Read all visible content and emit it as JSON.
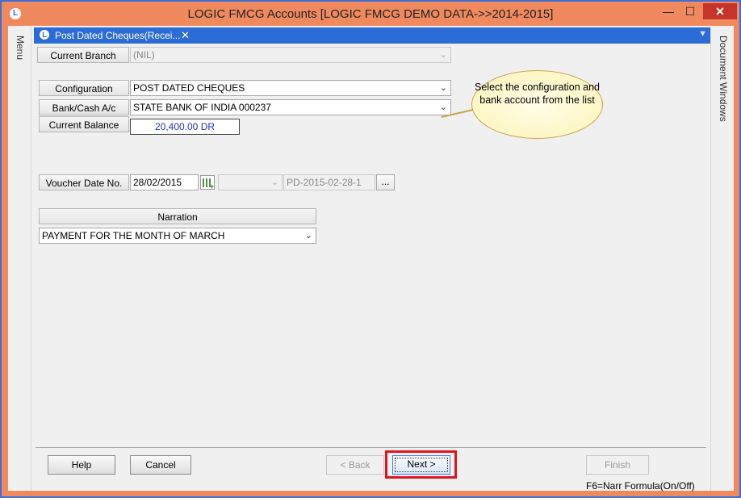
{
  "window": {
    "title": "LOGIC FMCG Accounts  [LOGIC FMCG DEMO DATA->>2014-2015]",
    "app_icon": "L",
    "controls": {
      "minimize": "—",
      "maximize": "☐",
      "close": "✕"
    }
  },
  "side": {
    "left_label": "Menu",
    "right_label": "Document Windows"
  },
  "tab": {
    "label": "Post Dated Cheques(Recei...",
    "close": "✕"
  },
  "form": {
    "branch": {
      "label": "Current Branch",
      "value": "(NIL)"
    },
    "configuration": {
      "label": "Configuration",
      "value": "POST DATED CHEQUES"
    },
    "bank": {
      "label": "Bank/Cash A/c",
      "value": "STATE BANK OF INDIA 000237"
    },
    "balance": {
      "label": "Current Balance",
      "value": "20,400.00 DR"
    },
    "voucher": {
      "label": "Voucher Date  No.",
      "date": "28/02/2015",
      "series": "",
      "number": "PD-2015-02-28-1",
      "dots": "..."
    },
    "narration": {
      "label": "Narration",
      "value": "PAYMENT FOR THE MONTH OF MARCH"
    }
  },
  "callout": {
    "text": "Select the configuration and bank account from the list"
  },
  "buttons": {
    "help": "Help",
    "cancel": "Cancel",
    "back": "< Back",
    "next": "Next >",
    "finish": "Finish"
  },
  "status": {
    "hint": "F6=Narr Formula(On/Off)"
  },
  "icons": {
    "dropdown": "chevron-down-icon",
    "calendar": "calendar-icon"
  },
  "colors": {
    "titlebar": "#f08a5e",
    "tab": "#2c6cd6",
    "highlight": "#e2121a",
    "balance_text": "#2034b5"
  }
}
